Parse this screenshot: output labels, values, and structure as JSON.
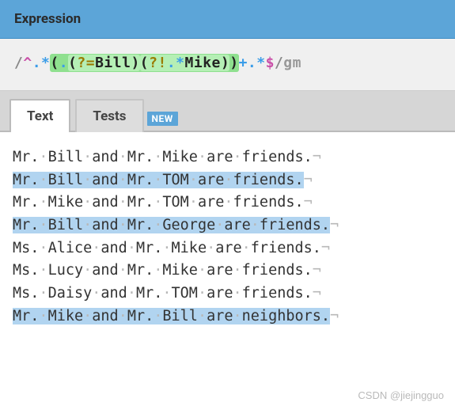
{
  "header": {
    "title": "Expression"
  },
  "regex": {
    "open_delim": "/",
    "t1_anchor": "^",
    "t2_dot": ".",
    "t3_star": "*",
    "t4_lparen1": "(",
    "t5_dot2": ".",
    "t6_lparen2": "(",
    "t7_look1": "?=",
    "t8_lit1": "Bill",
    "t9_rparen2": ")",
    "t10_lparen3": "(",
    "t11_look2": "?!",
    "t12_dot3": ".",
    "t13_star2": "*",
    "t14_lit2": "Mike",
    "t15_rparen3": ")",
    "t16_rparen1": ")",
    "t17_plus": "+",
    "t18_dot4": ".",
    "t19_star3": "*",
    "t20_anchor2": "$",
    "close_delim": "/",
    "flags": "gm"
  },
  "tabs": {
    "text_label": "Text",
    "tests_label": "Tests",
    "badge": "NEW"
  },
  "lines": [
    {
      "raw": "Mr. Bill and Mr. Mike are friends.",
      "highlighted": false
    },
    {
      "raw": "Mr. Bill and Mr. TOM are friends.",
      "highlighted": true
    },
    {
      "raw": "Mr. Mike and Mr. TOM are friends.",
      "highlighted": false
    },
    {
      "raw": "Mr. Bill and Mr. George are friends.",
      "highlighted": true
    },
    {
      "raw": "Ms. Alice and Mr. Mike are friends.",
      "highlighted": false
    },
    {
      "raw": "Ms. Lucy and Mr. Mike are friends.",
      "highlighted": false
    },
    {
      "raw": "Ms. Daisy and Mr. TOM are friends.",
      "highlighted": false
    },
    {
      "raw": "Mr. Mike and Mr. Bill are neighbors.",
      "highlighted": true
    }
  ],
  "watermark": "CSDN @jiejingguo"
}
